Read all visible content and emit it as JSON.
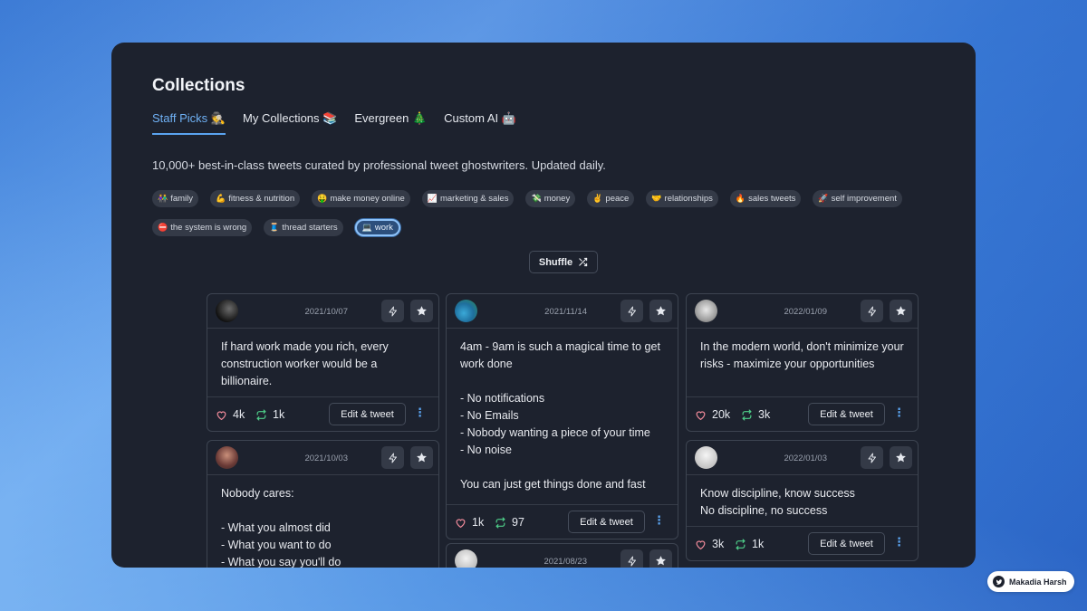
{
  "page": {
    "title": "Collections",
    "description": "10,000+ best-in-class tweets curated by professional tweet ghostwriters. Updated daily."
  },
  "tabs": [
    {
      "label": "Staff Picks",
      "emoji": "🕵️"
    },
    {
      "label": "My Collections",
      "emoji": "📚"
    },
    {
      "label": "Evergreen",
      "emoji": "🎄"
    },
    {
      "label": "Custom AI",
      "emoji": "🤖"
    }
  ],
  "tags": [
    {
      "emoji": "👫",
      "label": "family"
    },
    {
      "emoji": "💪",
      "label": "fitness & nutrition"
    },
    {
      "emoji": "🤑",
      "label": "make money online"
    },
    {
      "emoji": "📈",
      "label": "marketing & sales"
    },
    {
      "emoji": "💸",
      "label": "money"
    },
    {
      "emoji": "✌️",
      "label": "peace"
    },
    {
      "emoji": "🤝",
      "label": "relationships"
    },
    {
      "emoji": "🔥",
      "label": "sales tweets"
    },
    {
      "emoji": "🚀",
      "label": "self improvement"
    },
    {
      "emoji": "⛔",
      "label": "the system is wrong"
    },
    {
      "emoji": "🧵",
      "label": "thread starters"
    },
    {
      "emoji": "💻",
      "label": "work"
    }
  ],
  "shuffle_label": "Shuffle",
  "edit_label": "Edit & tweet",
  "cards": [
    {
      "date": "2021/10/07",
      "text": "If hard work made you rich, every construction worker would be a billionaire.",
      "likes": "4k",
      "retweets": "1k"
    },
    {
      "date": "2021/10/03",
      "text": "Nobody cares:\n\n- What you almost did\n- What you want to do\n- What you say you'll do",
      "likes": "",
      "retweets": ""
    },
    {
      "date": "2021/11/14",
      "text": "4am - 9am is such a magical time to get work done\n\n- No notifications\n- No Emails\n- Nobody wanting a piece of your time\n- No noise\n\nYou can just get things done and fast",
      "likes": "1k",
      "retweets": "97"
    },
    {
      "date": "2021/08/23",
      "text": "",
      "likes": "",
      "retweets": ""
    },
    {
      "date": "2022/01/09",
      "text": "In the modern world, don't minimize your risks - maximize your opportunities",
      "likes": "20k",
      "retweets": "3k"
    },
    {
      "date": "2022/01/03",
      "text": "Know discipline, know success\nNo discipline, no success",
      "likes": "3k",
      "retweets": "1k"
    }
  ],
  "badge": {
    "name": "Makadia Harsh"
  },
  "colors": {
    "accent": "#5aa3ef",
    "panel": "#1d222e",
    "like": "#f08a9a",
    "retweet": "#4fd08a"
  },
  "selected_tag": "work",
  "selected_tab": "Staff Picks"
}
